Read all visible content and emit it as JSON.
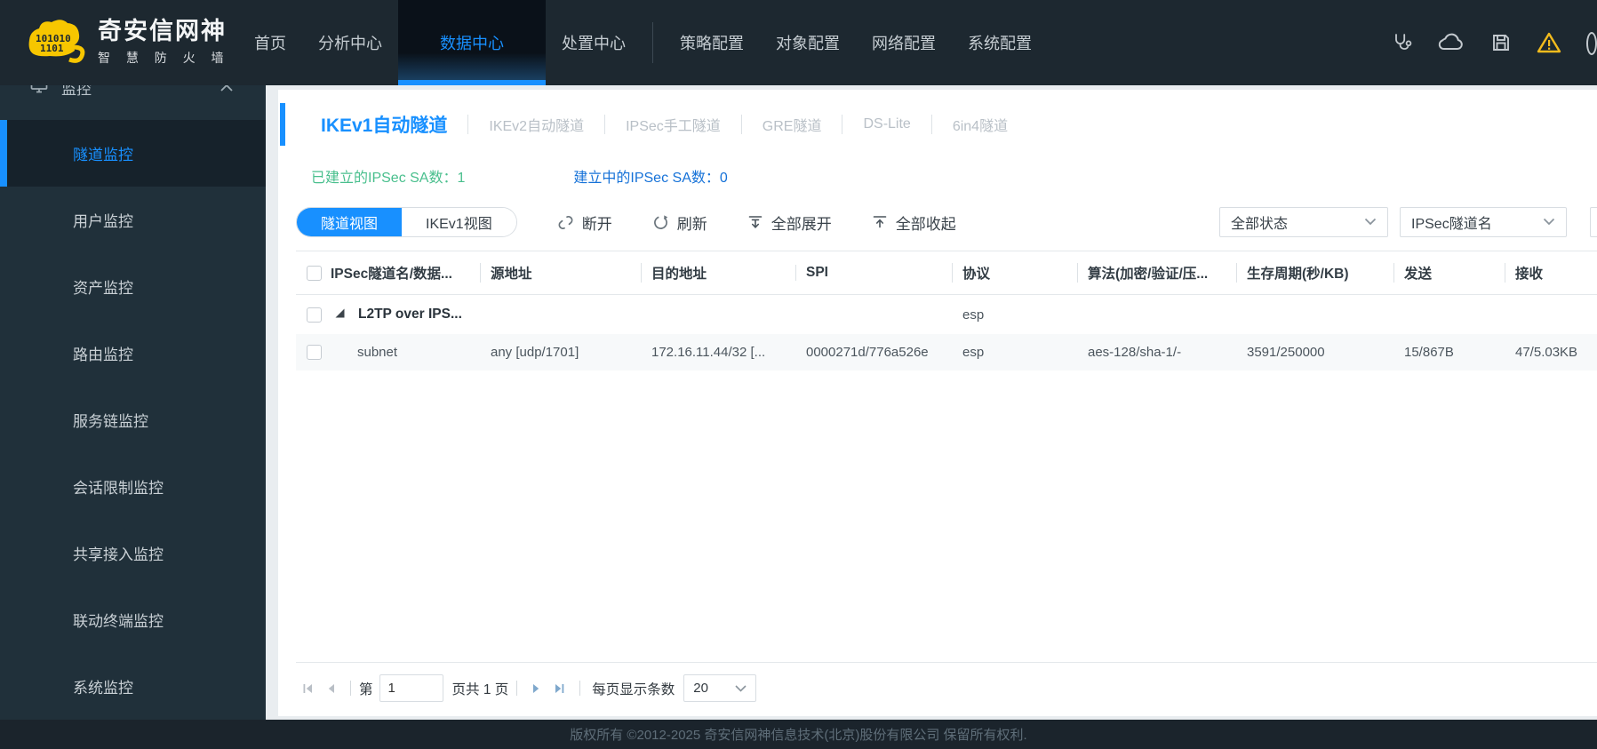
{
  "header": {
    "brand": {
      "title": "奇安信网神",
      "subtitle": "智 慧 防 火 墙"
    },
    "nav": [
      {
        "label": "首页"
      },
      {
        "label": "分析中心"
      },
      {
        "label": "数据中心",
        "active": true
      },
      {
        "label": "处置中心"
      },
      {
        "label": "策略配置"
      },
      {
        "label": "对象配置"
      },
      {
        "label": "网络配置"
      },
      {
        "label": "系统配置"
      }
    ],
    "icons": [
      "stethoscope-icon",
      "cloud-icon",
      "save-icon",
      "warning-icon",
      "partial-circle-icon"
    ]
  },
  "sidebar": {
    "group_label": "监控",
    "items": [
      {
        "label": "隧道监控",
        "active": true
      },
      {
        "label": "用户监控"
      },
      {
        "label": "资产监控"
      },
      {
        "label": "路由监控"
      },
      {
        "label": "服务链监控"
      },
      {
        "label": "会话限制监控"
      },
      {
        "label": "共享接入监控"
      },
      {
        "label": "联动终端监控"
      },
      {
        "label": "系统监控"
      }
    ]
  },
  "tabs": [
    {
      "label": "IKEv1自动隧道",
      "active": true
    },
    {
      "label": "IKEv2自动隧道"
    },
    {
      "label": "IPSec手工隧道"
    },
    {
      "label": "GRE隧道"
    },
    {
      "label": "DS-Lite"
    },
    {
      "label": "6in4隧道"
    }
  ],
  "status": {
    "established_text": "已建立的IPSec SA数：1",
    "establishing_text": "建立中的IPSec SA数：0"
  },
  "toolbar": {
    "tunnel_view_label": "隧道视图",
    "ikev1_view_label": "IKEv1视图",
    "disconnect_label": "断开",
    "refresh_label": "刷新",
    "expand_all_label": "全部展开",
    "collapse_all_label": "全部收起",
    "status_filter_value": "全部状态",
    "name_filter_value": "IPSec隧道名"
  },
  "table": {
    "columns": [
      "IPSec隧道名/数据...",
      "源地址",
      "目的地址",
      "SPI",
      "协议",
      "算法(加密/验证/压...",
      "生存周期(秒/KB)",
      "发送",
      "接收"
    ],
    "group_row": {
      "name": "L2TP over IPS...",
      "protocol": "esp"
    },
    "rows": [
      {
        "name": "subnet",
        "source": "any [udp/1701]",
        "destination": "172.16.11.44/32 [...",
        "spi": "0000271d/776a526e",
        "protocol": "esp",
        "algorithm": "aes-128/sha-1/-",
        "lifetime": "3591/250000",
        "sent": "15/867B",
        "received": "47/5.03KB"
      }
    ]
  },
  "pagination": {
    "page_prefix": "第",
    "page_value": "1",
    "page_info": "页共 1 页",
    "per_page_label": "每页显示条数",
    "per_page_value": "20"
  },
  "footer": {
    "copyright": "版权所有 ©2012-2025 奇安信网神信息技术(北京)股份有限公司 保留所有权利."
  },
  "colors": {
    "accent": "#1890ff",
    "established_green": "#49bf8d",
    "establishing_blue": "#1672d8",
    "warning_yellow": "#f2bb1d",
    "header_bg": "#1d2830",
    "sidebar_bg": "#20303a",
    "footer_bg": "#1b242c",
    "page_bg": "#e9edf0"
  }
}
